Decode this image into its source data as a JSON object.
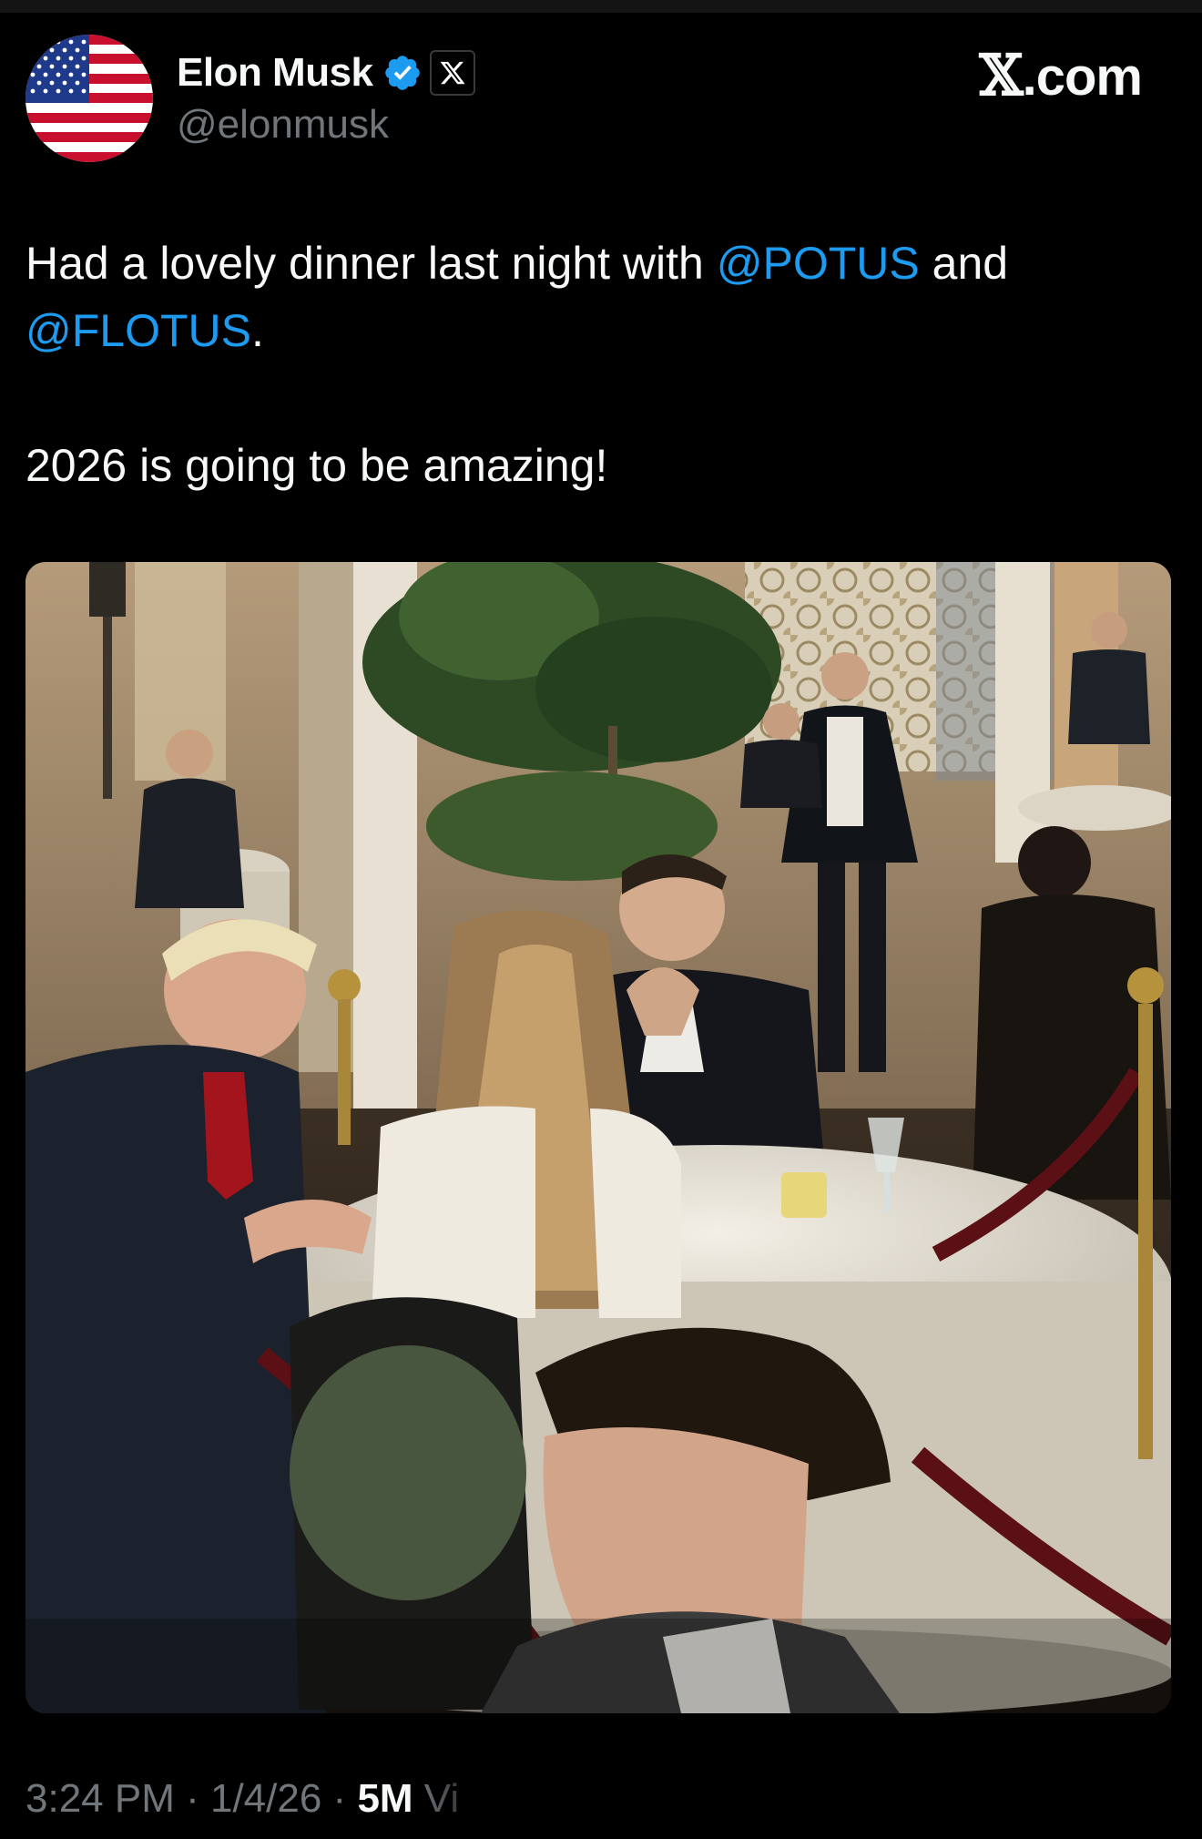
{
  "author": {
    "display_name": "Elon Musk",
    "handle": "@elonmusk",
    "avatar_icon": "us-flag-avatar",
    "verified_icon": "verified-badge-icon",
    "affiliation_icon": "x-logo-badge-icon"
  },
  "brand": {
    "x_glyph": "𝕏",
    "suffix": ".com"
  },
  "tweet": {
    "text_part1": "Had a lovely dinner last night with ",
    "mention1": "@POTUS",
    "text_part2": " and ",
    "mention2": "@FLOTUS",
    "text_part3": ".",
    "line2": "2026 is going to be amazing!",
    "image_alt": "photo of a dinner in an ornate restaurant"
  },
  "meta": {
    "time": "3:24 PM",
    "sep1": " · ",
    "date": "1/4/26",
    "sep2": " · ",
    "views_count": "5M",
    "views_label": " Vi"
  },
  "colors": {
    "background": "#000000",
    "text": "#f7f9f9",
    "secondary": "#71767b",
    "accent": "#1d9bf0"
  }
}
